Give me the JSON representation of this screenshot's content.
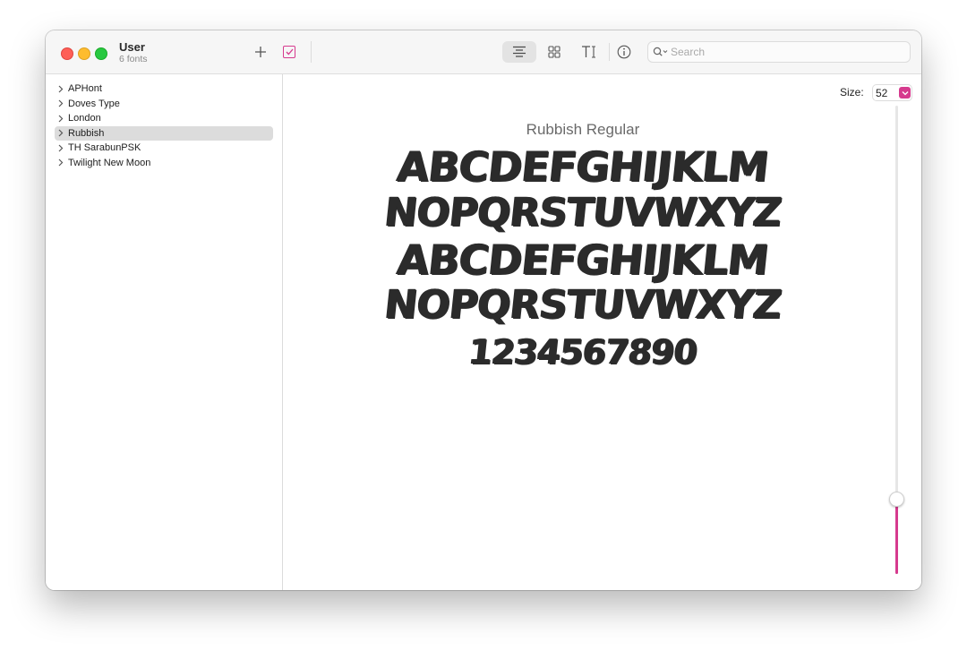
{
  "window": {
    "title": "User",
    "subtitle": "6 fonts"
  },
  "toolbar": {
    "add_icon": "plus-icon",
    "check_icon": "checkbox-icon",
    "view_sample_icon": "align-center-icon",
    "view_grid_icon": "grid-icon",
    "text_size_icon": "text-size-icon",
    "info_icon": "info-icon",
    "search_placeholder": "Search",
    "search_value": "",
    "accent": "#d63a8e"
  },
  "sidebar": {
    "items": [
      {
        "label": "APHont",
        "selected": false
      },
      {
        "label": "Doves Type",
        "selected": false
      },
      {
        "label": "London",
        "selected": false
      },
      {
        "label": "Rubbish",
        "selected": true
      },
      {
        "label": "TH SarabunPSK",
        "selected": false
      },
      {
        "label": "Twilight New Moon",
        "selected": false
      }
    ]
  },
  "preview": {
    "size_label": "Size:",
    "size_value": "52",
    "font_name": "Rubbish Regular",
    "lines": [
      "ABCDEFGHIJKLM",
      "NOPQRSTUVWXYZ",
      "ABCDEFGHIJKLM",
      "NOPQRSTUVWXYZ",
      "1234567890"
    ],
    "size_slider_fraction": 0.16
  }
}
